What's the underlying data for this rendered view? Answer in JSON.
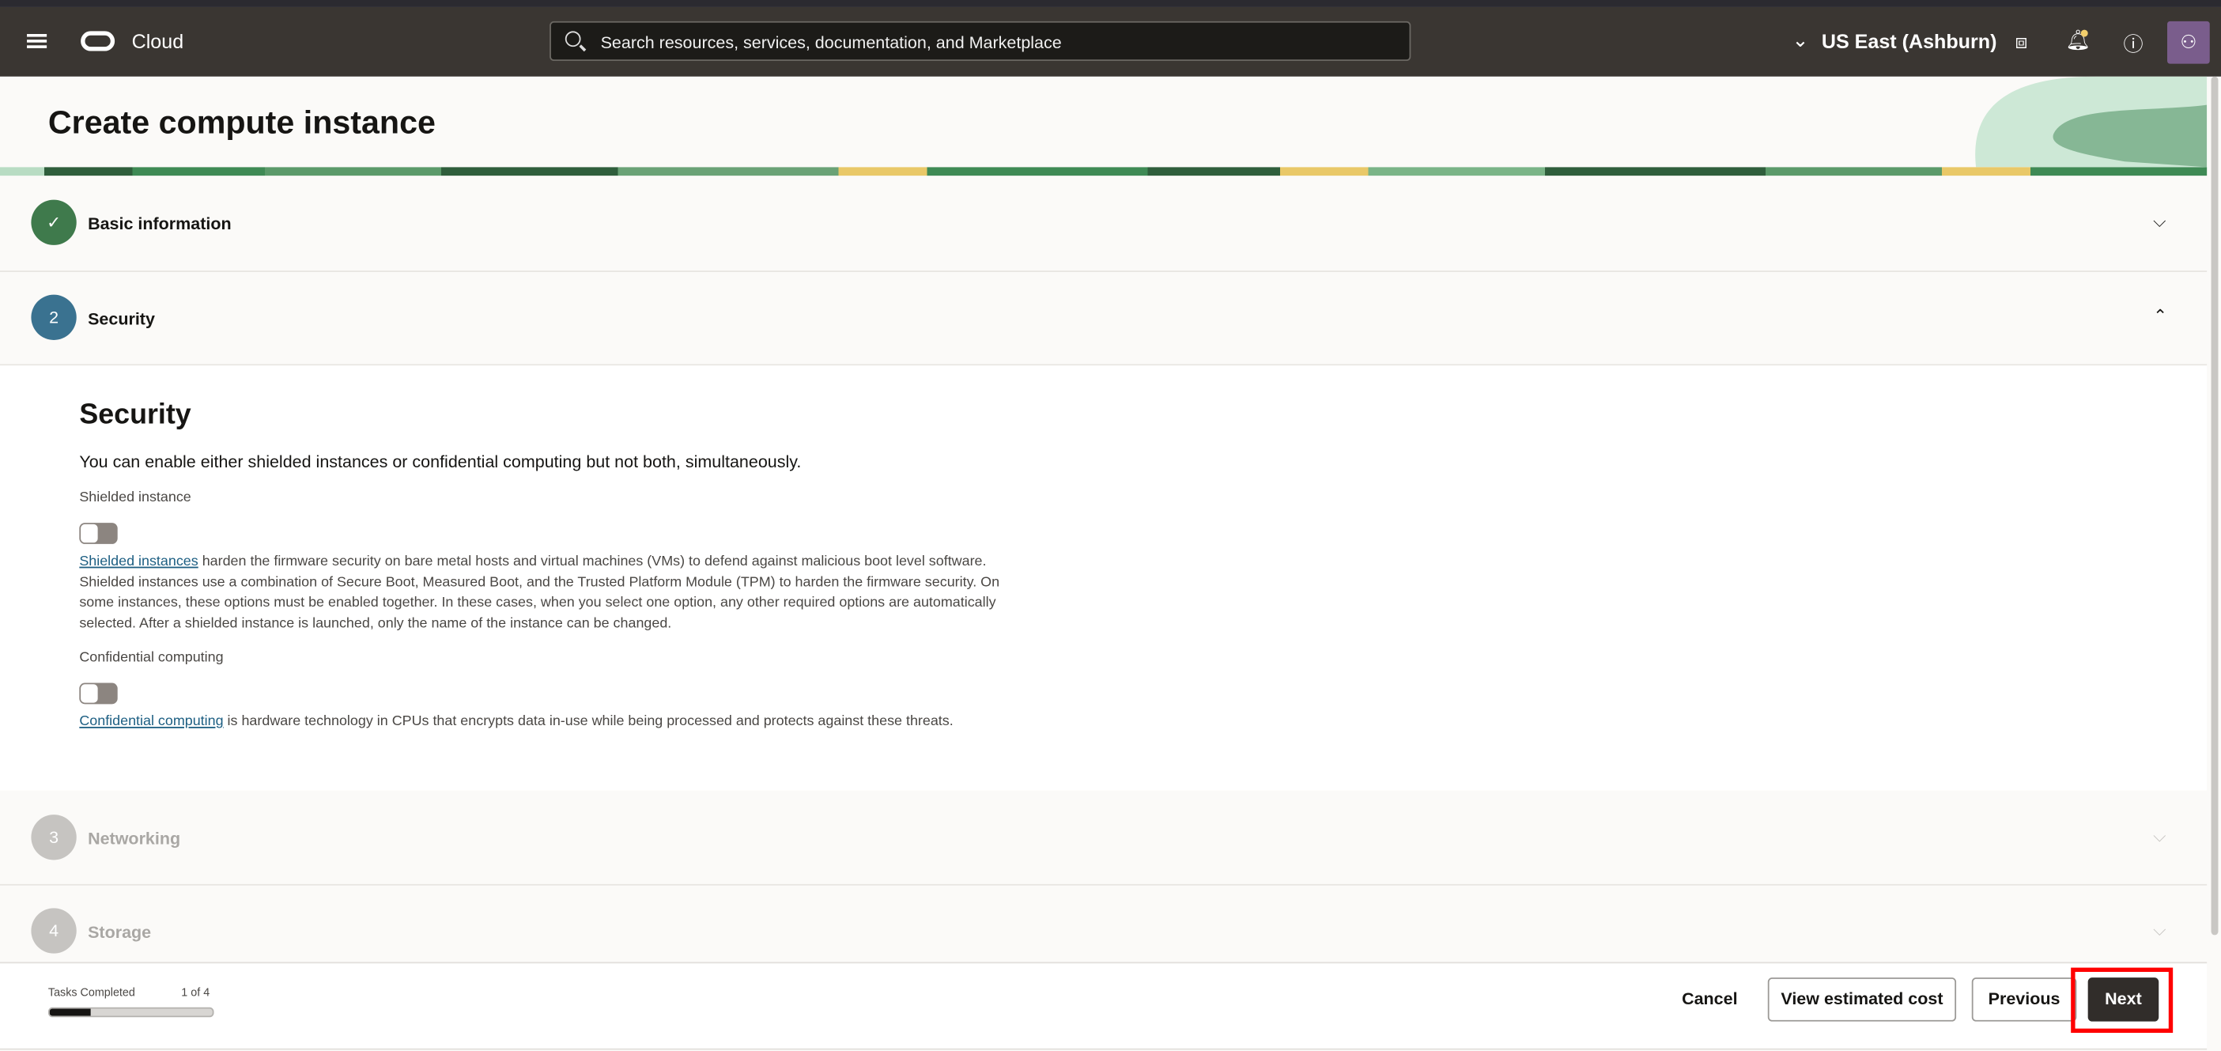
{
  "header": {
    "brand": "Cloud",
    "search_placeholder": "Search resources, services, documentation, and Marketplace",
    "region": "US East (Ashburn)",
    "icons": [
      "menu-icon",
      "oracle-logo",
      "search-icon",
      "chevron-down-icon",
      "code-editor-icon",
      "bell-icon",
      "help-icon",
      "user-icon"
    ]
  },
  "page": {
    "title": "Create compute instance"
  },
  "steps": [
    {
      "number": "✓",
      "label": "Basic information",
      "state": "completed"
    },
    {
      "number": "2",
      "label": "Security",
      "state": "active"
    },
    {
      "number": "3",
      "label": "Networking",
      "state": "disabled"
    },
    {
      "number": "4",
      "label": "Storage",
      "state": "disabled"
    }
  ],
  "security": {
    "heading": "Security",
    "intro": "You can enable either shielded instances or confidential computing but not both, simultaneously.",
    "shielded": {
      "label": "Shielded instance",
      "enabled": false,
      "link": "Shielded instances",
      "text": " harden the firmware security on bare metal hosts and virtual machines (VMs) to defend against malicious boot level software. Shielded instances use a combination of Secure Boot, Measured Boot, and the Trusted Platform Module (TPM) to harden the firmware security. On some instances, these options must be enabled together. In these cases, when you select one option, any other required options are automatically selected. After a shielded instance is launched, only the name of the instance can be changed."
    },
    "confidential": {
      "label": "Confidential computing",
      "enabled": false,
      "link": "Confidential computing",
      "text": " is hardware technology in CPUs that encrypts data in-use while being processed and protects against these threats."
    }
  },
  "footer": {
    "tasks_label": "Tasks Completed",
    "tasks_count": "1 of 4",
    "progress_fraction": 0.25,
    "cancel": "Cancel",
    "view_cost": "View estimated cost",
    "previous": "Previous",
    "next": "Next"
  },
  "colors": {
    "header": "#3a3632",
    "link": "#1c5e82",
    "completed": "#3f7a4c",
    "active": "#3a7290",
    "primary_button": "#312d2a",
    "highlight": "#ff0000"
  }
}
